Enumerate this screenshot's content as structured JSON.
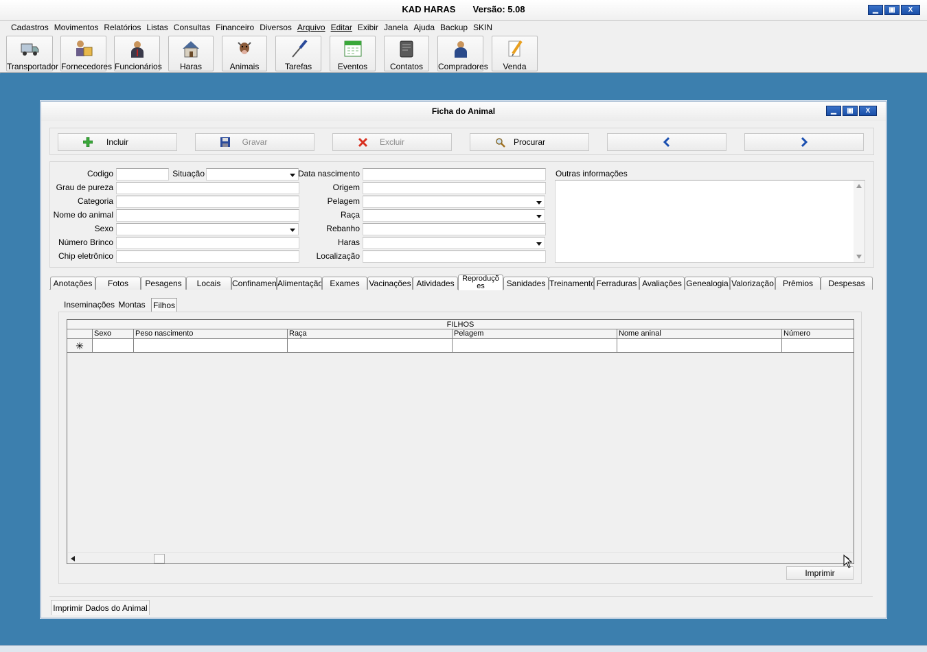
{
  "app": {
    "title": "KAD HARAS",
    "version": "Versão: 5.08"
  },
  "window_controls": {
    "minimize": "▁",
    "maximize": "▣",
    "close": "X"
  },
  "menu": [
    "Cadastros",
    "Movimentos",
    "Relatórios",
    "Listas",
    "Consultas",
    "Financeiro",
    "Diversos",
    "Arquivo",
    "Editar",
    "Exibir",
    "Janela",
    "Ajuda",
    "Backup",
    "SKIN"
  ],
  "toolbar": [
    {
      "label": "Transportador",
      "icon": "truck-icon"
    },
    {
      "label": "Fornecedores",
      "icon": "suppliers-icon"
    },
    {
      "label": "Funcionários",
      "icon": "employee-icon"
    },
    {
      "label": "Haras",
      "icon": "house-icon"
    },
    {
      "label": "Animais",
      "icon": "cow-icon"
    },
    {
      "label": "Tarefas",
      "icon": "screwdriver-icon"
    },
    {
      "label": "Eventos",
      "icon": "calendar-icon"
    },
    {
      "label": "Contatos",
      "icon": "address-book-icon"
    },
    {
      "label": "Compradores",
      "icon": "buyer-icon"
    },
    {
      "label": "Venda",
      "icon": "pencil-note-icon"
    }
  ],
  "form": {
    "title": "Ficha do Animal",
    "actions": {
      "incluir": "Incluir",
      "gravar": "Gravar",
      "excluir": "Excluir",
      "procurar": "Procurar"
    },
    "labels": {
      "codigo": "Codigo",
      "situacao": "Situação",
      "grau": "Grau de pureza",
      "categoria": "Categoria",
      "nome": "Nome do animal",
      "sexo": "Sexo",
      "brinco": "Número Brinco",
      "chip": "Chip eletrônico",
      "data_nasc": "Data nascimento",
      "origem": "Origem",
      "pelagem": "Pelagem",
      "raca": "Raça",
      "rebanho": "Rebanho",
      "haras": "Haras",
      "localizacao": "Localização",
      "outras": "Outras informações"
    },
    "values": {
      "codigo": "",
      "situacao": "",
      "grau": "",
      "categoria": "",
      "nome": "",
      "sexo": "",
      "brinco": "",
      "chip": "",
      "data_nasc": "",
      "origem": "",
      "pelagem": "",
      "raca": "",
      "rebanho": "",
      "haras": "",
      "localizacao": "",
      "outras": ""
    },
    "tabs": [
      "Anotações",
      "Fotos",
      "Pesagens",
      "Locais",
      "Confinamen",
      "Alimentação",
      "Exames",
      "Vacinações",
      "Atividades",
      "Reproduçõ es",
      "Sanidades",
      "Treinamentos",
      "Ferraduras",
      "Avaliações",
      "Genealogia",
      "Valorização",
      "Prêmios",
      "Despesas"
    ],
    "active_tab": "Reproduçõ es",
    "subtabs": [
      "Inseminações",
      "Montas",
      "Filhos"
    ],
    "active_subtab": "Filhos",
    "grid": {
      "title": "FILHOS",
      "columns": [
        "Sexo",
        "Peso nascimento",
        "Raça",
        "Pelagem",
        "Nome aninal",
        "Número"
      ],
      "new_row_marker": "✳"
    },
    "print_button": "Imprimir",
    "bottom_tab": "Imprimir Dados do Animal"
  }
}
